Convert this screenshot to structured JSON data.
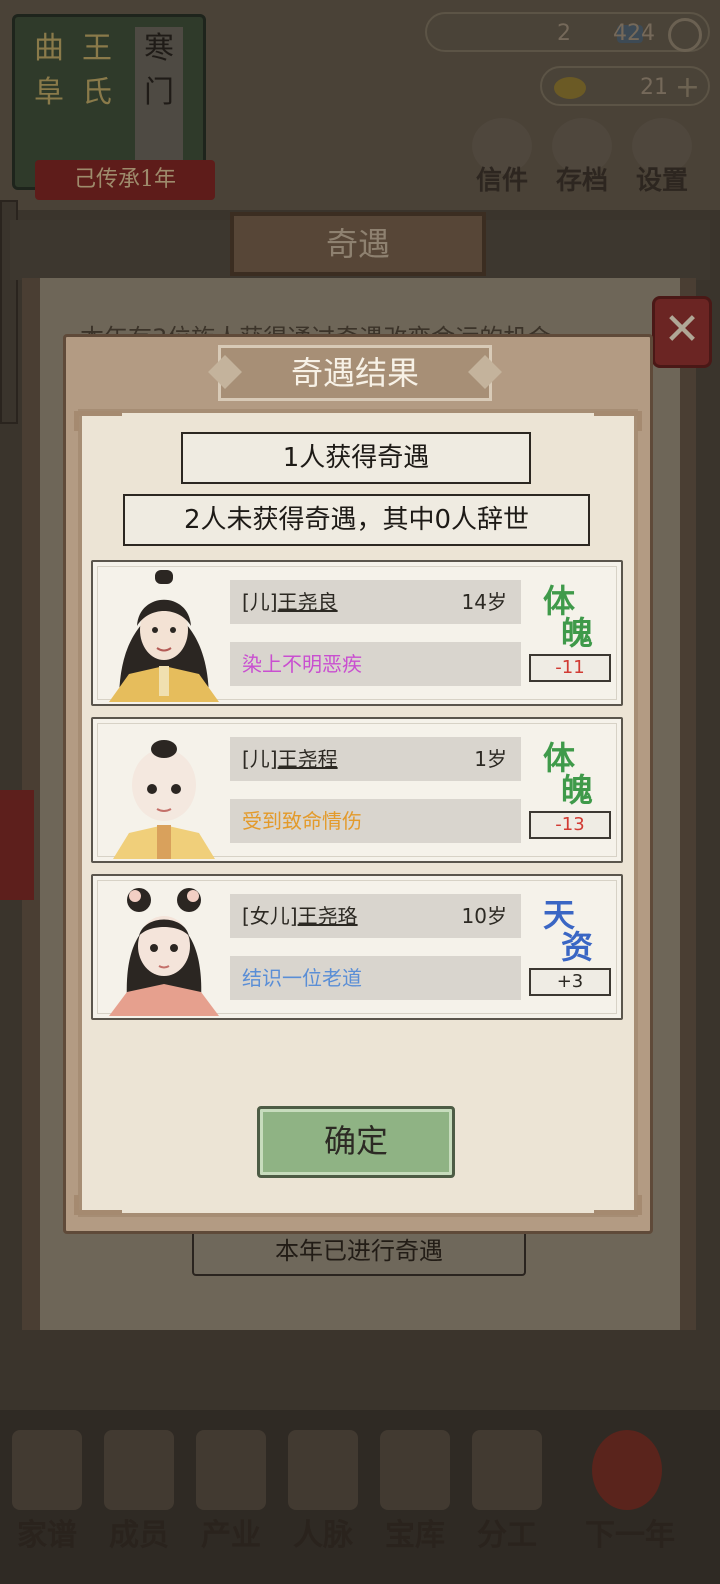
{
  "header": {
    "banner": {
      "col1": "曲阜",
      "col2": "王氏",
      "col3": "寒门"
    },
    "inherit_label": "己传承1年",
    "resource1": {
      "count_a": "2",
      "count_b": "424"
    },
    "resource2": {
      "count": "21"
    },
    "buttons": {
      "letters": "信件",
      "save": "存档",
      "settings": "设置"
    }
  },
  "scroll": {
    "title": "奇遇",
    "intro_text": "本年有3位族人获得通过奇遇改变命运的机会",
    "done_label": "本年已进行奇遇",
    "close_glyph": "✕"
  },
  "dialog": {
    "title": "奇遇结果",
    "summary1": "1人获得奇遇",
    "summary2": "2人未获得奇遇，其中0人辞世",
    "confirm_label": "确定",
    "members": [
      {
        "relation": "[儿]",
        "name": "王尧良",
        "age": "14岁",
        "event": "染上不明恶疾",
        "event_color": "#c94fd0",
        "attr_c1": "体",
        "attr_c2": "魄",
        "attr_color": "#3f9a4a",
        "delta": "-11",
        "delta_color": "#d13b33"
      },
      {
        "relation": "[儿]",
        "name": "王尧程",
        "age": "1岁",
        "event": "受到致命情伤",
        "event_color": "#e39a2a",
        "attr_c1": "体",
        "attr_c2": "魄",
        "attr_color": "#3f9a4a",
        "delta": "-13",
        "delta_color": "#d13b33"
      },
      {
        "relation": "[女儿]",
        "name": "王尧珞",
        "age": "10岁",
        "event": "结识一位老道",
        "event_color": "#5a8ed6",
        "attr_c1": "天",
        "attr_c2": "资",
        "attr_color": "#3a66c4",
        "delta": "+3",
        "delta_color": "#2c2923"
      }
    ]
  },
  "bottom_nav": [
    {
      "label": "家谱",
      "icon": "book-icon"
    },
    {
      "label": "成员",
      "icon": "person-icon"
    },
    {
      "label": "产业",
      "icon": "building-icon"
    },
    {
      "label": "人脉",
      "icon": "network-icon"
    },
    {
      "label": "宝库",
      "icon": "chest-icon"
    },
    {
      "label": "分工",
      "icon": "scroll-icon"
    },
    {
      "label": "下一年",
      "icon": "lantern-icon"
    }
  ]
}
